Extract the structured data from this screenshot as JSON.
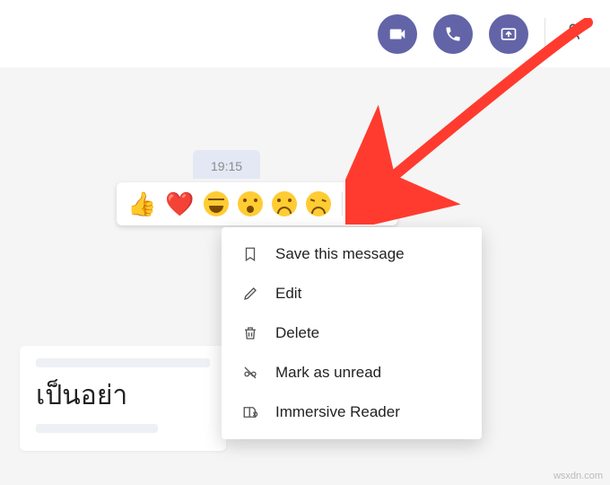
{
  "header": {
    "actions": {
      "video": "video-call",
      "audio": "audio-call",
      "share": "share-screen",
      "people_add": "add-people"
    }
  },
  "message": {
    "timestamp": "19:15"
  },
  "reactions": {
    "like": "👍",
    "heart": "❤️"
  },
  "menu": {
    "save": "Save this message",
    "edit": "Edit",
    "delete": "Delete",
    "mark_unread": "Mark as unread",
    "immersive": "Immersive Reader"
  },
  "compose": {
    "text": "เป็นอย่า"
  },
  "watermark": "wsxdn.com",
  "colors": {
    "accent": "#6264a7",
    "annotation": "#ff3b2f"
  }
}
